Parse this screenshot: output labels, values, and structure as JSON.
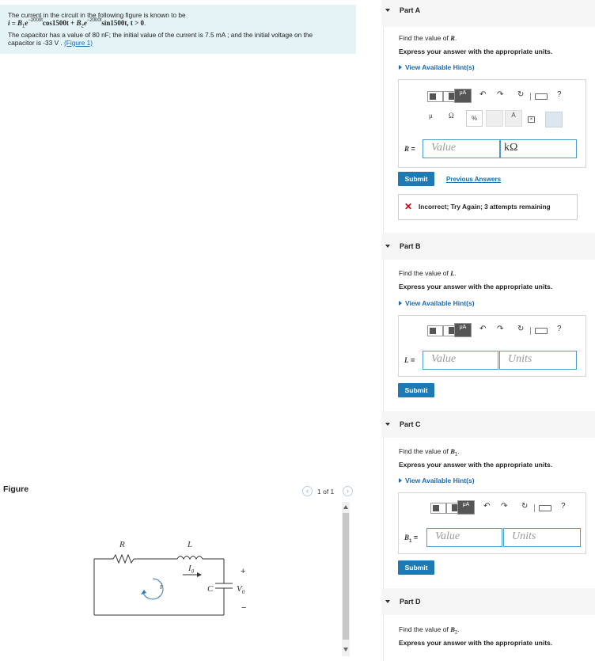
{
  "problem": {
    "line1": "The current in the circuit in the following figure is known to be",
    "eq_i": "i",
    "eq_eq": " = ",
    "eq_B1": "B",
    "eq_B1sub": "1",
    "eq_e1": "e",
    "eq_exp1": "−2000t",
    "eq_cos": "cos1500t + ",
    "eq_B2": "B",
    "eq_B2sub": "2",
    "eq_e2": "e",
    "eq_exp2": "−2000t",
    "eq_sin": "sin1500t, t > 0",
    "eq_end": ".",
    "line3": "The capacitor has a value of 80 nF; the initial value of the current is 7.5 mA ; and the initial voltage on the",
    "line4": "capacitor is -33 V .",
    "figure_link": "(Figure 1)"
  },
  "figure": {
    "label": "Figure",
    "page": "1 of 1",
    "prev_icon": "chevron-left-icon",
    "next_icon": "chevron-right-icon",
    "circuit": {
      "R": "R",
      "L": "L",
      "I0": "I",
      "I0sub": "0",
      "i": "i",
      "C": "C",
      "V0": "V",
      "V0sub": "0",
      "plus": "+",
      "minus": "−"
    }
  },
  "parts": {
    "a": {
      "title": "Part A",
      "find_pre": "Find the value of ",
      "var": "R",
      "find_post": ".",
      "express": "Express your answer with the appropriate units.",
      "hint": "View Available Hint(s)",
      "label_var": "R",
      "label_eq": " =",
      "value_placeholder": "Value",
      "unit_value": "kΩ",
      "submit": "Submit",
      "previous": "Previous Answers",
      "feedback": "Incorrect; Try Again; 3 attempts remaining",
      "toolbar_symbols": [
        "μ",
        "Ω",
        "%",
        "A"
      ]
    },
    "b": {
      "title": "Part B",
      "find_pre": "Find the value of ",
      "var": "L",
      "find_post": ".",
      "express": "Express your answer with the appropriate units.",
      "hint": "View Available Hint(s)",
      "label_var": "L",
      "label_eq": " =",
      "value_placeholder": "Value",
      "unit_placeholder": "Units",
      "submit": "Submit"
    },
    "c": {
      "title": "Part C",
      "find_pre": "Find the value of ",
      "var": "B",
      "var_sub": "1",
      "find_post": ".",
      "express": "Express your answer with the appropriate units.",
      "hint": "View Available Hint(s)",
      "label_var": "B",
      "label_sub": "1",
      "label_eq": " =",
      "value_placeholder": "Value",
      "unit_placeholder": "Units",
      "submit": "Submit"
    },
    "d": {
      "title": "Part D",
      "find_pre": "Find the value of ",
      "var": "B",
      "var_sub": "2",
      "find_post": ".",
      "express": "Express your answer with the appropriate units."
    }
  },
  "toolbar": {
    "units_icon": "μA",
    "help": "?"
  },
  "colors": {
    "accent": "#1f7ab3",
    "link": "#1a6ab0",
    "problem_bg": "#e4f3f5",
    "error": "#d0021b"
  }
}
